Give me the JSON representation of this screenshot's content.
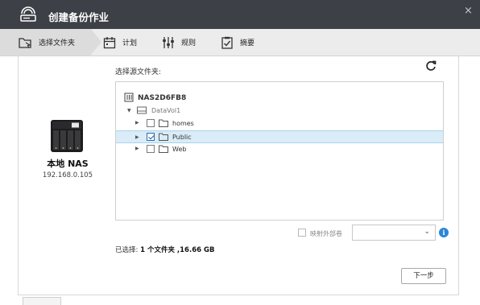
{
  "window": {
    "title": "创建备份作业",
    "close_glyph": "×",
    "logo_icon": "backup-job-icon"
  },
  "steps": [
    {
      "label": "选择文件夹",
      "icon": "folder-select-icon",
      "active": true
    },
    {
      "label": "计划",
      "icon": "calendar-icon",
      "active": false
    },
    {
      "label": "规则",
      "icon": "sliders-icon",
      "active": false
    },
    {
      "label": "摘要",
      "icon": "clipboard-icon",
      "active": false
    }
  ],
  "source_nas": {
    "name": "本地 NAS",
    "ip": "192.168.0.105"
  },
  "folder_picker": {
    "label": "选择源文件夹:",
    "server": "NAS2D6FB8",
    "volume": "DataVol1",
    "folders": [
      {
        "name": "homes",
        "checked": false,
        "selected": false
      },
      {
        "name": "Public",
        "checked": true,
        "selected": true
      },
      {
        "name": "Web",
        "checked": false,
        "selected": false
      }
    ]
  },
  "mapping": {
    "checkbox_label": "映射外部卷",
    "select_value": "",
    "info_glyph": "i"
  },
  "summary": {
    "prefix": "已选择: ",
    "value": "1 个文件夹 ,16.66 GB"
  },
  "buttons": {
    "next": "下一步"
  },
  "colors": {
    "titlebar": "#3d4046",
    "selection": "#d9ecf7",
    "accent": "#2b86d6"
  }
}
